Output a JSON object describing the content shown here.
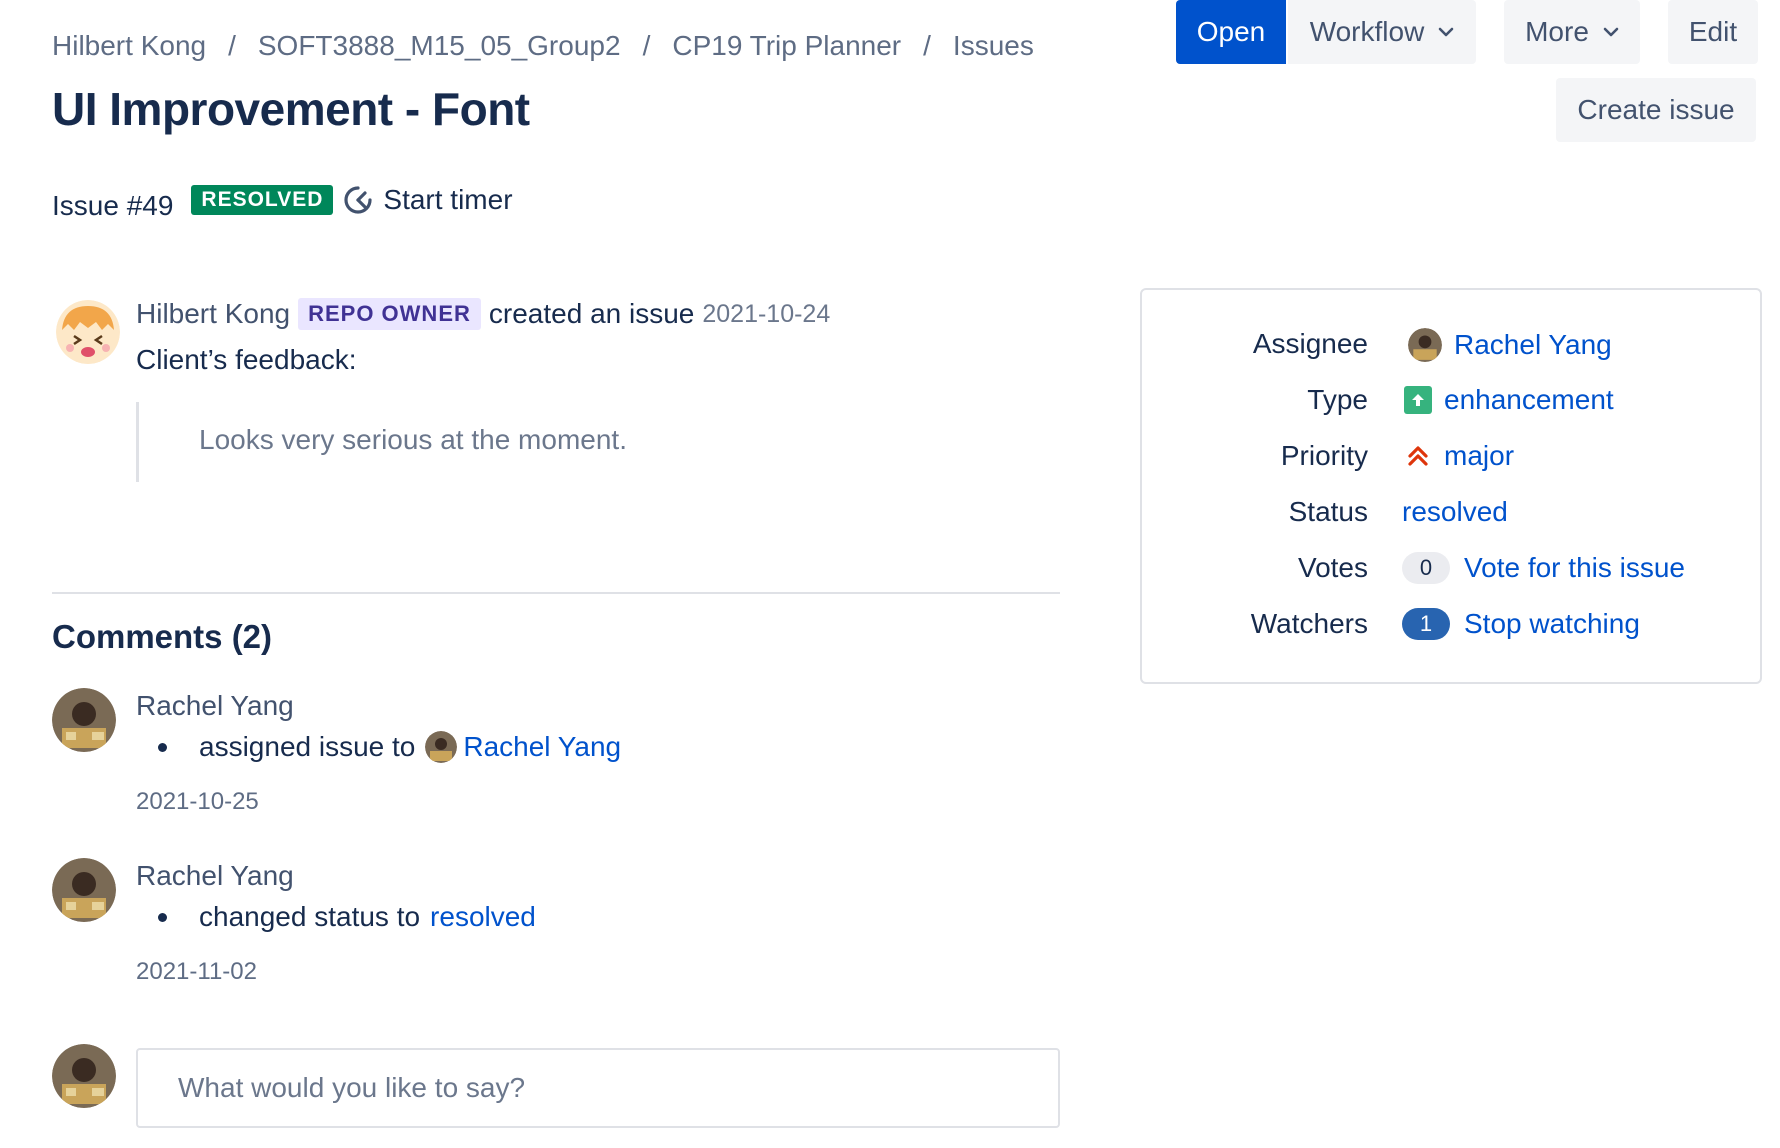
{
  "breadcrumb": {
    "items": [
      "Hilbert Kong",
      "SOFT3888_M15_05_Group2",
      "CP19 Trip Planner",
      "Issues"
    ],
    "separator": "/"
  },
  "issue": {
    "title": "UI Improvement - Font",
    "number_label": "Issue #49",
    "status_badge": "RESOLVED",
    "timer_label": "Start timer"
  },
  "toolbar": {
    "create_issue": "Create issue",
    "open": "Open",
    "workflow": "Workflow",
    "more": "More",
    "edit": "Edit"
  },
  "event": {
    "author": "Hilbert Kong",
    "badge": "REPO OWNER",
    "action": "created an issue",
    "date": "2021-10-24",
    "body_intro": "Client’s feedback:",
    "quote": "Looks very serious at the moment."
  },
  "comments": {
    "heading": "Comments (2)",
    "items": [
      {
        "author": "Rachel Yang",
        "action": "assigned issue to",
        "target": "Rachel Yang",
        "date": "2021-10-25"
      },
      {
        "author": "Rachel Yang",
        "action": "changed status to",
        "target": "resolved",
        "date": "2021-11-02"
      }
    ],
    "reply_placeholder": "What would you like to say?"
  },
  "details": {
    "assignee": {
      "label": "Assignee",
      "value": "Rachel Yang"
    },
    "type": {
      "label": "Type",
      "value": "enhancement"
    },
    "priority": {
      "label": "Priority",
      "value": "major"
    },
    "status": {
      "label": "Status",
      "value": "resolved"
    },
    "votes": {
      "label": "Votes",
      "count": "0",
      "action": "Vote for this issue"
    },
    "watchers": {
      "label": "Watchers",
      "count": "1",
      "action": "Stop watching"
    }
  },
  "colors": {
    "primary": "#0052cc",
    "resolved": "#00875a",
    "enhancement": "#36b37e",
    "major": "#de350b",
    "owner_badge_bg": "#eae6ff"
  },
  "icons": {
    "timer": "timer-icon",
    "type": "enhancement-icon",
    "priority": "priority-major-icon",
    "chevron": "chevron-down-icon"
  }
}
